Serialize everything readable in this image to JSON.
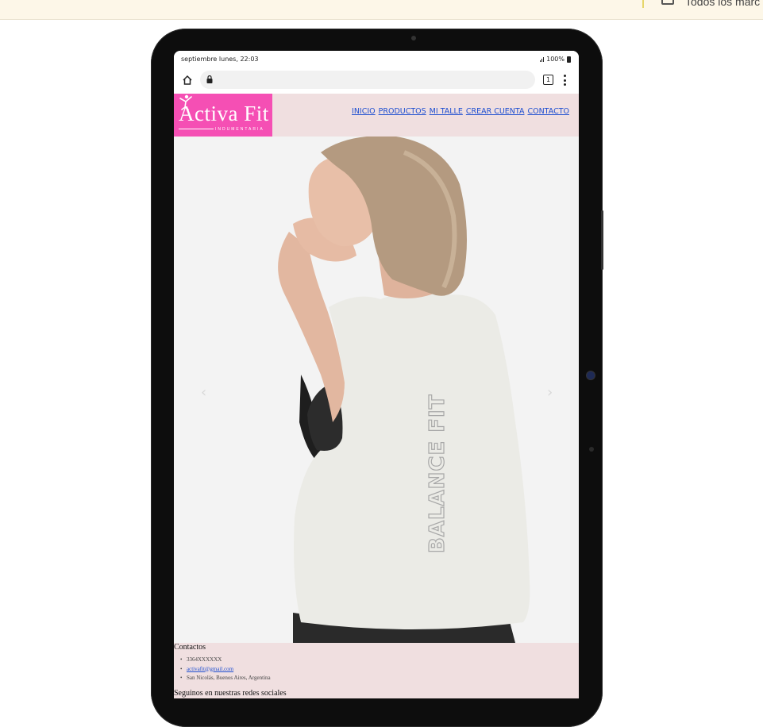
{
  "browser": {
    "bookmarks_label": "Todos los marc"
  },
  "device": {
    "status": {
      "time": "septiembre lunes, 22:03",
      "battery": "100%"
    },
    "tabs_count": "1"
  },
  "site": {
    "logo": {
      "name": "Activa Fit",
      "tagline": "INDUMENTARIA"
    },
    "nav": [
      {
        "label": "INICIO"
      },
      {
        "label": "PRODUCTOS"
      },
      {
        "label": "MI TALLE"
      },
      {
        "label": "CREAR CUENTA"
      },
      {
        "label": "CONTACTO"
      }
    ],
    "hero": {
      "shirt_print": "BALANCE FIT",
      "prev_label": "‹",
      "next_label": "›"
    },
    "footer": {
      "contacts_title": "Contactos",
      "phone": "3364XXXXXX",
      "email": "activafit@gmail.com",
      "address": "San Nicolás, Buenos Aires, Argentina",
      "social_title": "Seguinos en nuestras redes sociales"
    }
  },
  "colors": {
    "logo_bg": "#f54fb4",
    "header_bg": "#f0dfe0",
    "link": "#1f4fd1",
    "bezel": "#0d0d0d"
  }
}
